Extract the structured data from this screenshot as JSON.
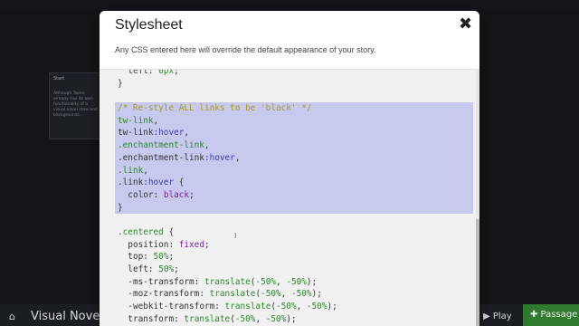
{
  "background": {
    "passage_title": "Start",
    "passage_text": "Although Twine already has its own functionality of a visual novel stow and backgrounds...",
    "story_title": "Visual Nove",
    "play_label": "▶ Play",
    "passage_label": "✚ Passage"
  },
  "modal": {
    "title": "Stylesheet",
    "close_label": "✖",
    "description": "Any CSS entered here will override the default appearance of your story."
  },
  "code_lines": [
    "  left: 0px;",
    "}",
    "",
    "/* Re-style ALL links to be 'black' */",
    "tw-link,",
    "tw-link:hover,",
    ".enchantment-link,",
    ".enchantment-link:hover,",
    ".link,",
    ".link:hover {",
    "  color: black;",
    "}",
    "",
    ".centered {",
    "  position: fixed;",
    "  top: 50%;",
    "  left: 50%;",
    "  -ms-transform: translate(-50%, -50%);",
    "  -moz-transform: translate(-50%, -50%);",
    "  -webkit-transform: translate(-50%, -50%);",
    "  transform: translate(-50%, -50%);"
  ],
  "colors": {
    "selection": "#c8c9ef",
    "editor_bg": "#f1f1f1",
    "passage_button": "#2f7a2f"
  }
}
